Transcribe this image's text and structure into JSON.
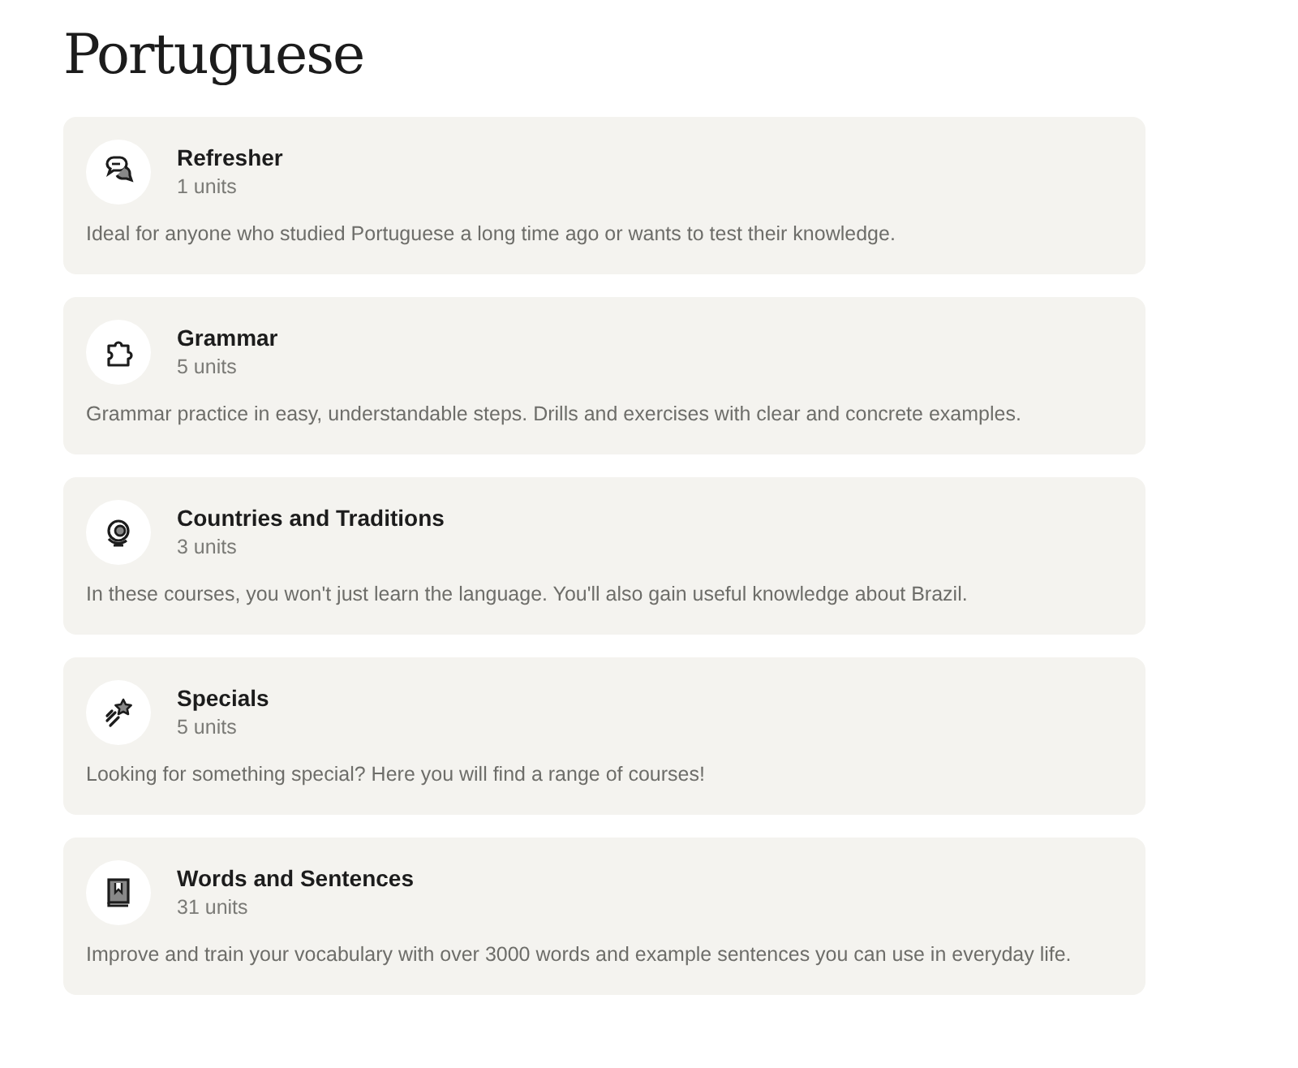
{
  "title": "Portuguese",
  "courses": [
    {
      "kind": "chat",
      "name": "Refresher",
      "units": "1 units",
      "description": "Ideal for anyone who studied Portuguese a long time ago or wants to test their knowledge."
    },
    {
      "kind": "puzzle",
      "name": "Grammar",
      "units": "5 units",
      "description": "Grammar practice in easy, understandable steps. Drills and exercises with clear and concrete examples."
    },
    {
      "kind": "globe",
      "name": "Countries and Traditions",
      "units": "3 units",
      "description": "In these courses, you won't just learn the language. You'll also gain useful knowledge about Brazil."
    },
    {
      "kind": "star",
      "name": "Specials",
      "units": "5 units",
      "description": "Looking for something special? Here you will find a range of courses!"
    },
    {
      "kind": "book",
      "name": "Words and Sentences",
      "units": "31 units",
      "description": "Improve and train your vocabulary with over 3000 words and example sentences you can use in everyday life."
    }
  ]
}
